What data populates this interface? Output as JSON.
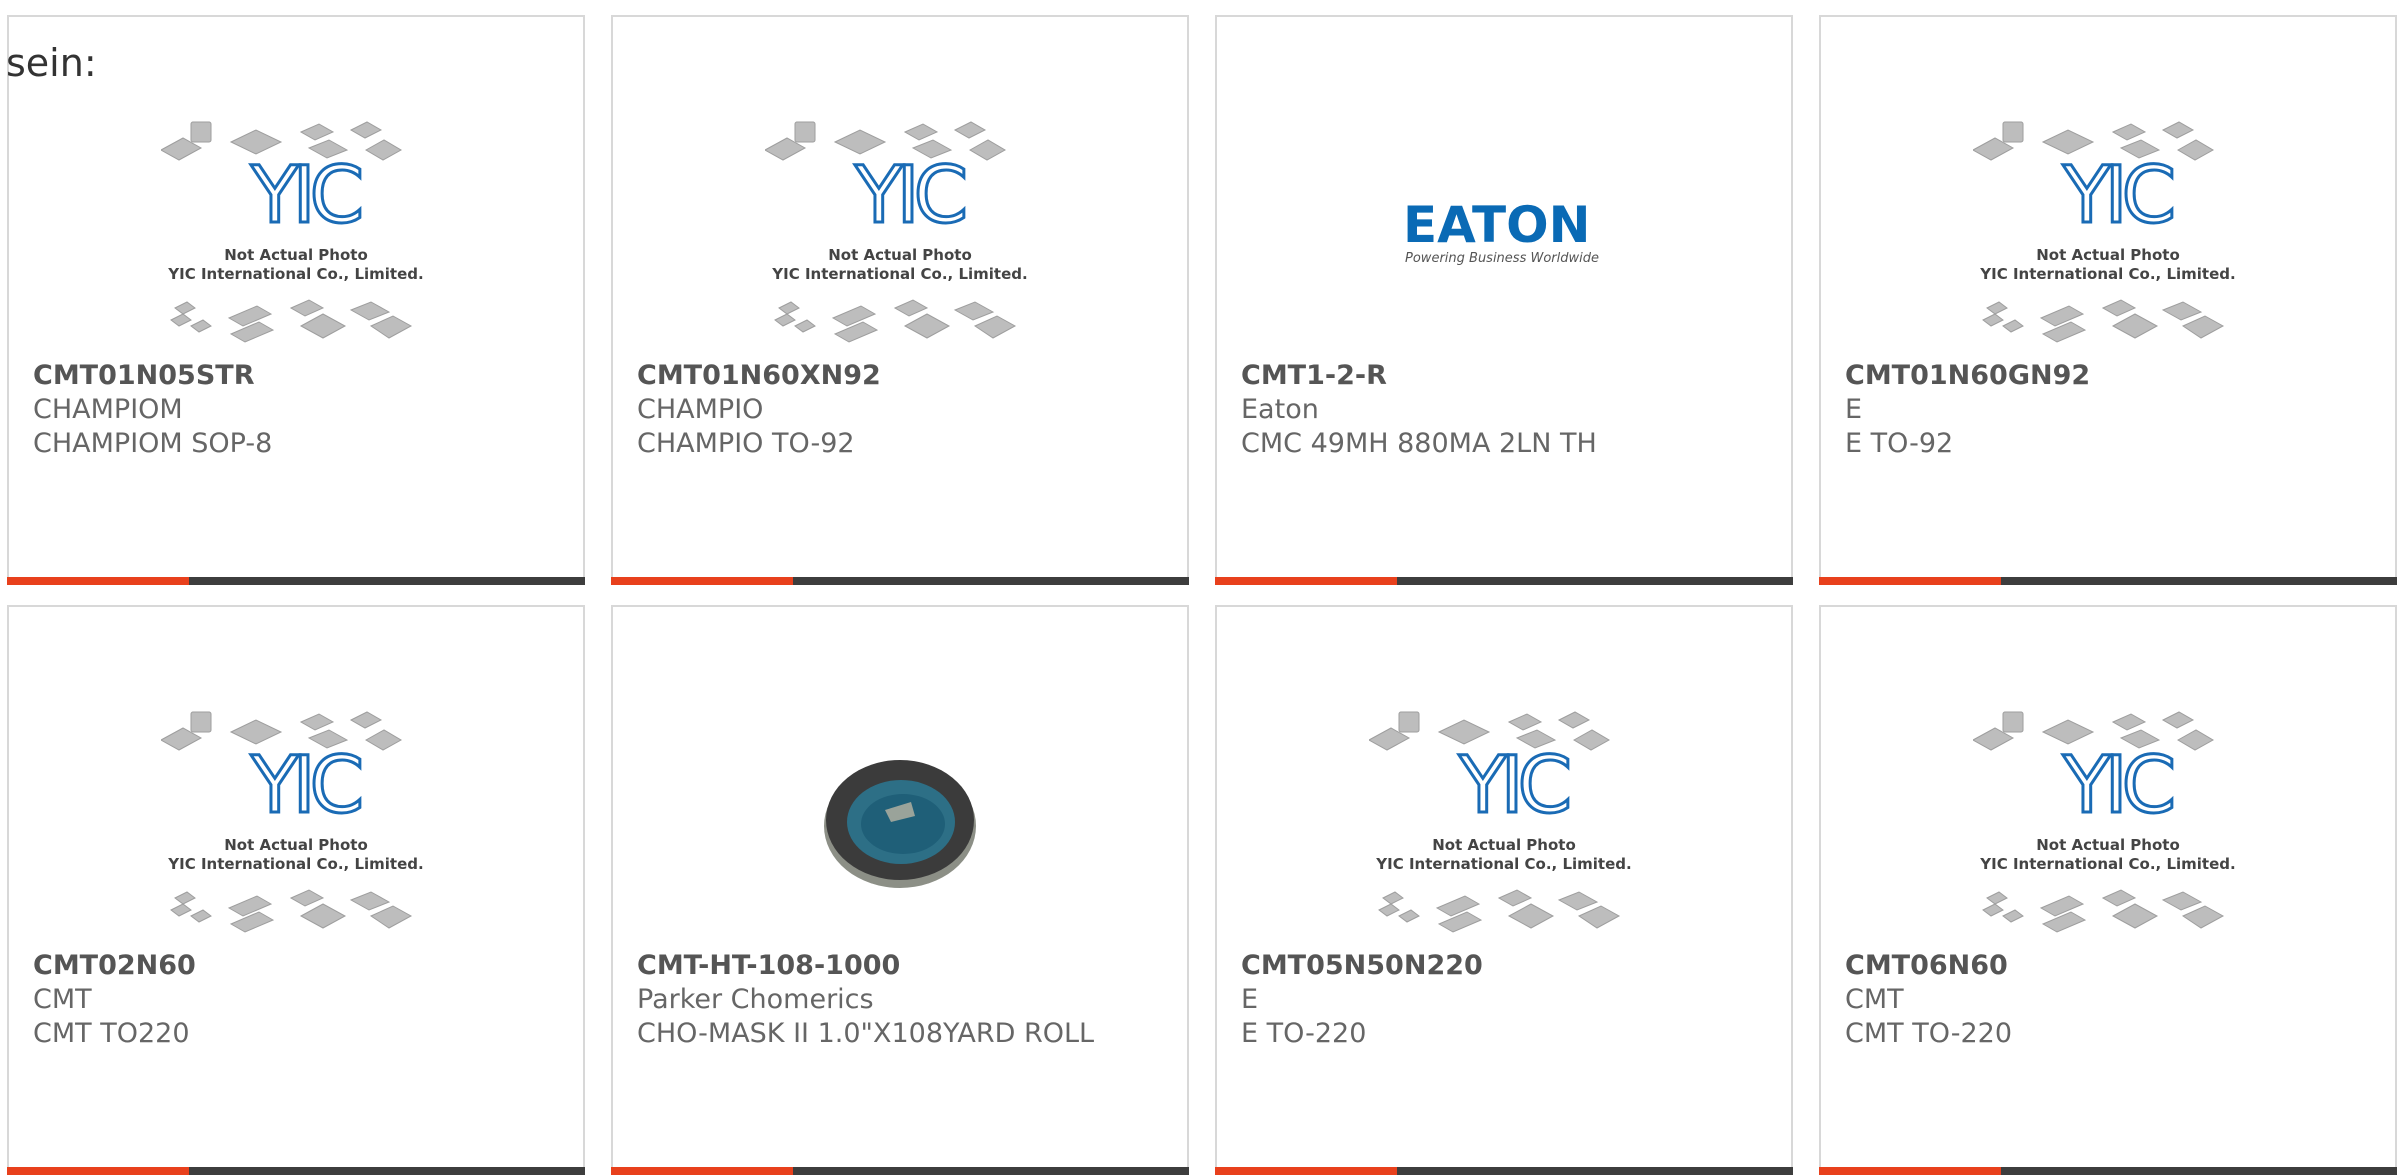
{
  "heading": "sein:",
  "colors": {
    "accent": "#e8401c",
    "bar": "#3d3d3d",
    "border": "#d8d8d8",
    "yic_blue": "#1a6bb5",
    "eaton_blue": "#0a6ab5"
  },
  "placeholder": {
    "line1": "Not Actual Photo",
    "line2": "YIC International Co., Limited.",
    "logo": "YIC"
  },
  "eaton": {
    "logo": "EATON",
    "tagline": "Powering Business Worldwide"
  },
  "products": [
    {
      "part": "CMT01N05STR",
      "maker": "CHAMPIOM",
      "desc": "CHAMPIOM SOP-8",
      "image": "yic-placeholder"
    },
    {
      "part": "CMT01N60XN92",
      "maker": "CHAMPIO",
      "desc": "CHAMPIO TO-92",
      "image": "yic-placeholder"
    },
    {
      "part": "CMT1-2-R",
      "maker": "Eaton",
      "desc": "CMC 49MH 880MA 2LN TH",
      "image": "eaton-logo"
    },
    {
      "part": "CMT01N60GN92",
      "maker": "E",
      "desc": "E TO-92",
      "image": "yic-placeholder"
    },
    {
      "part": "CMT02N60",
      "maker": "CMT",
      "desc": "CMT TO220",
      "image": "yic-placeholder"
    },
    {
      "part": "CMT-HT-108-1000",
      "maker": "Parker Chomerics",
      "desc": "CHO-MASK II 1.0\"X108YARD ROLL",
      "image": "tape-roll"
    },
    {
      "part": "CMT05N50N220",
      "maker": "E",
      "desc": "E TO-220",
      "image": "yic-placeholder"
    },
    {
      "part": "CMT06N60",
      "maker": "CMT",
      "desc": "CMT TO-220",
      "image": "yic-placeholder"
    }
  ]
}
